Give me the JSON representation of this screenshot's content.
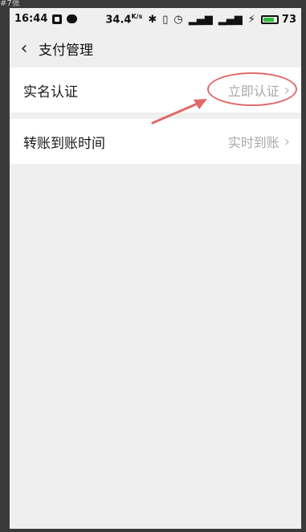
{
  "corner_label": "#7张",
  "status": {
    "time": "16:44",
    "speed": "34.4",
    "speed_unit": "K/s",
    "battery": "73"
  },
  "header": {
    "back_icon": "chevron-left-icon",
    "title": "支付管理"
  },
  "rows": [
    {
      "label": "实名认证",
      "value": "立即认证"
    },
    {
      "label": "转账到账时间",
      "value": "实时到账"
    }
  ],
  "colors": {
    "annotation": "#e06a6a",
    "background": "#efefef"
  }
}
